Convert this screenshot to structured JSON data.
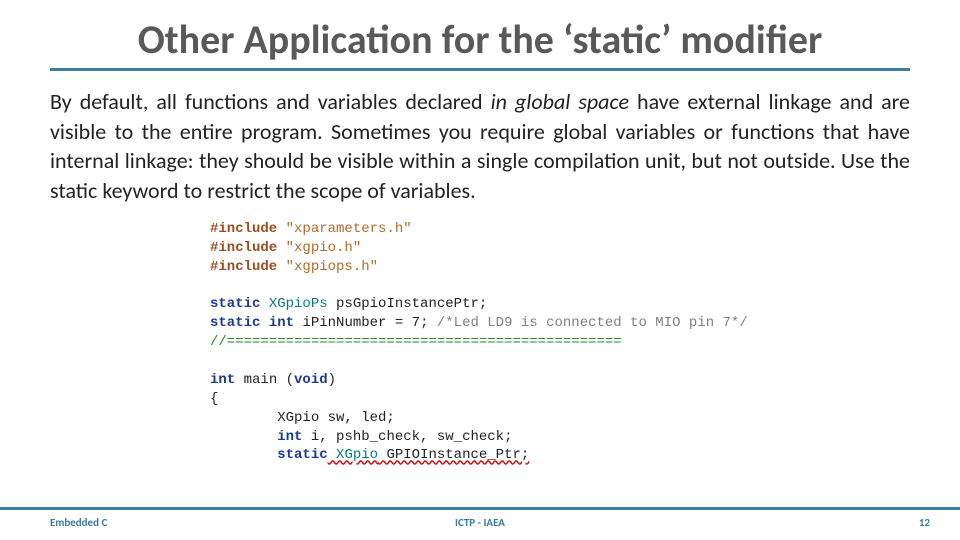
{
  "title": "Other Application for the ‘static’ modifier",
  "body": {
    "pre_italic": "By default, all functions and variables declared ",
    "italic": "in global space",
    "post_italic": " have external linkage and are visible to the entire program. Sometimes you require global variables or functions that have internal linkage: they should be visible within a single compilation unit, but not outside. Use the static keyword to restrict the scope of variables."
  },
  "code": {
    "include1_kw": "#include",
    "include1_str": " \"xparameters.h\"",
    "include2_kw": "#include",
    "include2_str": " \"xgpio.h\"",
    "include3_kw": "#include",
    "include3_str": " \"xgpiops.h\"",
    "l_static": "static",
    "l_int": "int",
    "l_void": "void",
    "type_xgpiops": " XGpioPs",
    "decl1_tail": " psGpioInstancePtr;",
    "decl2_mid": " iPinNumber = 7; ",
    "decl2_comment": "/*Led LD9 is connected to MIO pin 7*/",
    "sep": "//===============================================",
    "main_sig_a": " main (",
    "main_sig_b": ")",
    "brace_open": "{",
    "body_line1a": "        XGpio sw, led;",
    "body_line2a": "        ",
    "body_line2b": " i, pshb_check, sw_check;",
    "body_line3_pre": "        ",
    "body_line3_type": " XGpio",
    "body_line3_tail": " GPIOInstance_Ptr;"
  },
  "footer": {
    "left": "Embedded C",
    "center": "ICTP - IAEA",
    "right": "12"
  }
}
